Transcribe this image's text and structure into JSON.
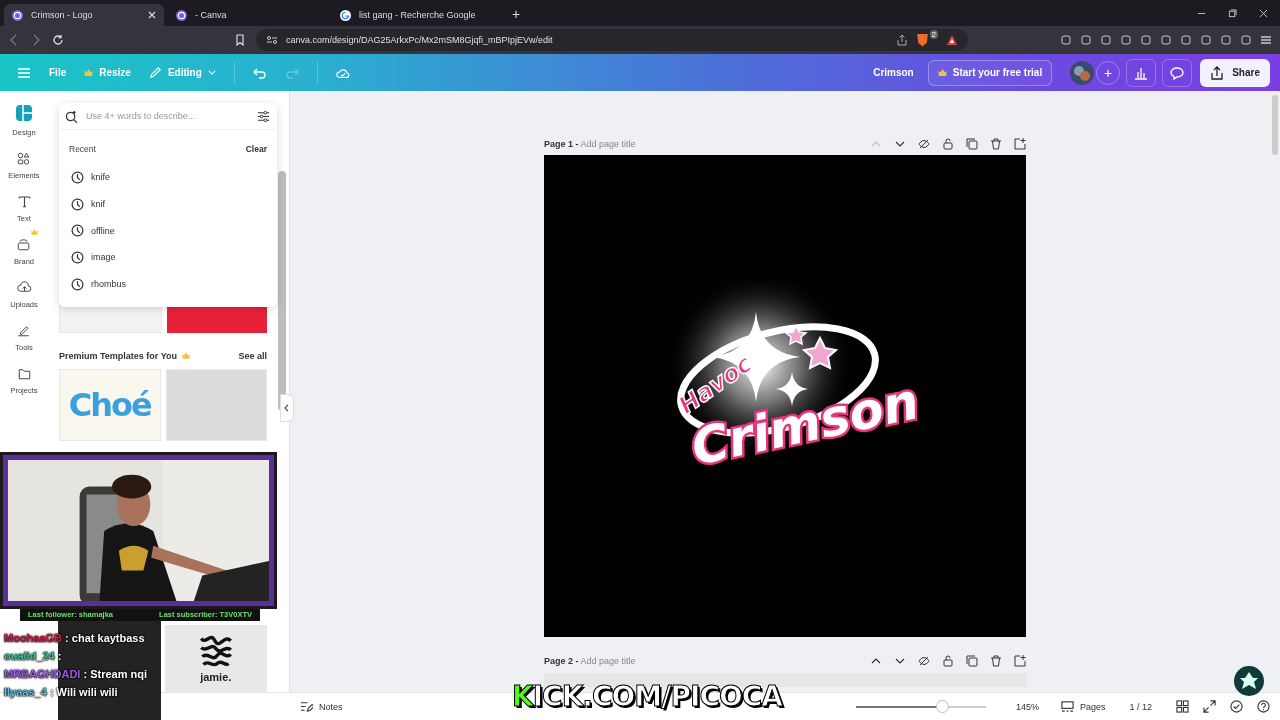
{
  "browser": {
    "tabs": [
      {
        "title": "Crimson - Logo",
        "selected": true
      },
      {
        "title": "- Canva",
        "selected": false
      },
      {
        "title": "list gang - Recherche Google",
        "selected": false
      }
    ],
    "new_tab": "+",
    "url": "canva.com/design/DAG25ArkxPc/Mx2mSM8Gjqfi_mBPIpjEVw/edit",
    "badge": "2"
  },
  "toolbar": {
    "file": "File",
    "resize": "Resize",
    "mode": "Editing",
    "redo_disabled": true,
    "design_name": "Crimson",
    "trial": "Start your free trial",
    "add": "+",
    "share": "Share"
  },
  "rail": [
    {
      "label": "Design",
      "selected": true
    },
    {
      "label": "Elements",
      "selected": false
    },
    {
      "label": "Text",
      "selected": false
    },
    {
      "label": "Brand",
      "selected": false
    },
    {
      "label": "Uploads",
      "selected": false
    },
    {
      "label": "Tools",
      "selected": false
    },
    {
      "label": "Projects",
      "selected": false
    }
  ],
  "search": {
    "placeholder": "Use 4+ words to describe...",
    "recent_title": "Recent",
    "clear": "Clear",
    "recent": [
      "knife",
      "knif",
      "offline",
      "image",
      "rhombus"
    ]
  },
  "panel": {
    "section_title": "Premium Templates for You",
    "see_all": "See all",
    "template_text": "Choé",
    "template_text_2": "jamie."
  },
  "pages": [
    {
      "label": "Page 1 -",
      "placeholder": "Add page title",
      "up_disabled": true
    },
    {
      "label": "Page 2 -",
      "placeholder": "Add page title",
      "up_disabled": false
    }
  ],
  "logo": {
    "small": "Havoc",
    "big": "Crimson"
  },
  "stream": {
    "follower": "Last follower: shamajka",
    "subscriber": "Last subscriber: T3V0XTV",
    "chat": [
      {
        "user": "MoohaaGB",
        "color": "#d8204a",
        "message": ": chat kaytbass"
      },
      {
        "user": "oualid_24",
        "color": "#3fc9a0",
        "message": ":"
      },
      {
        "user": "MRBAGHDADI",
        "color": "#9b59e6",
        "message": ": Stream nqi"
      },
      {
        "user": "Ilyaas_4",
        "color": "#5fc4e8",
        "message": ": Wili wili wili"
      }
    ],
    "kick": "KICK.COM/PICOCA"
  },
  "footer": {
    "notes": "Notes",
    "zoom": {
      "level": 0.67
    },
    "zoom_text": "145%",
    "pages": "Pages",
    "page_count": "1 / 12"
  }
}
